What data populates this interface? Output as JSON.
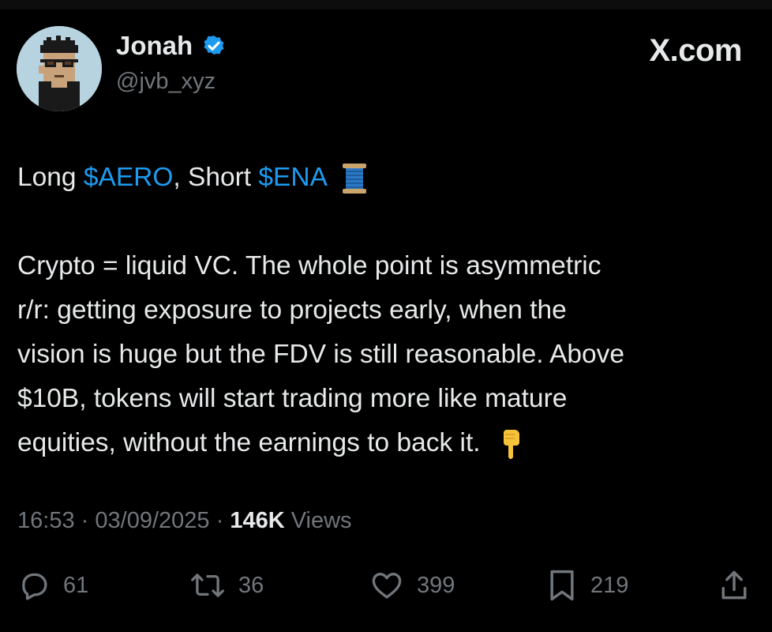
{
  "brand": {
    "label": "X.com"
  },
  "author": {
    "display_name": "Jonah",
    "handle": "@jvb_xyz",
    "verified": true,
    "avatar_icon": "pixel-art-avatar"
  },
  "tweet": {
    "line1": {
      "prefix": "Long ",
      "cashtag1": "$AERO",
      "middle": ", Short ",
      "cashtag2": "$ENA",
      "emoji": "thread-spool-emoji"
    },
    "paragraph": [
      "Crypto = liquid VC. The whole point is asymmetric",
      "r/r: getting exposure to projects early, when the",
      "vision is huge but the FDV is still reasonable. Above",
      "$10B, tokens will start trading more like mature",
      "equities, without the earnings to back it."
    ],
    "trailing_emoji": "pointing-down-hand-emoji"
  },
  "meta": {
    "time": "16:53",
    "date": "03/09/2025",
    "separator": "·",
    "views_count": "146K",
    "views_label": "Views"
  },
  "actions": {
    "replies": "61",
    "reposts": "36",
    "likes": "399",
    "bookmarks": "219"
  },
  "colors": {
    "background": "#000000",
    "text": "#e7e9ea",
    "secondary": "#71767b",
    "cashtag": "#1d9bf0",
    "verified_badge": "#1d9bf0"
  }
}
